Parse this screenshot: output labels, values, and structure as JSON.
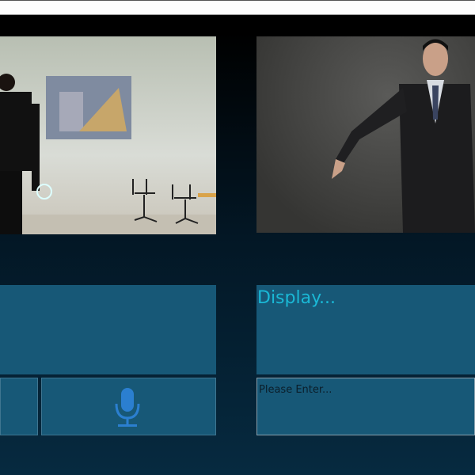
{
  "display": {
    "text": "Display..."
  },
  "input": {
    "placeholder": "Please Enter..."
  },
  "colors": {
    "panel": "#175877",
    "accent": "#1ab8d6",
    "mic": "#2b7fd0"
  }
}
